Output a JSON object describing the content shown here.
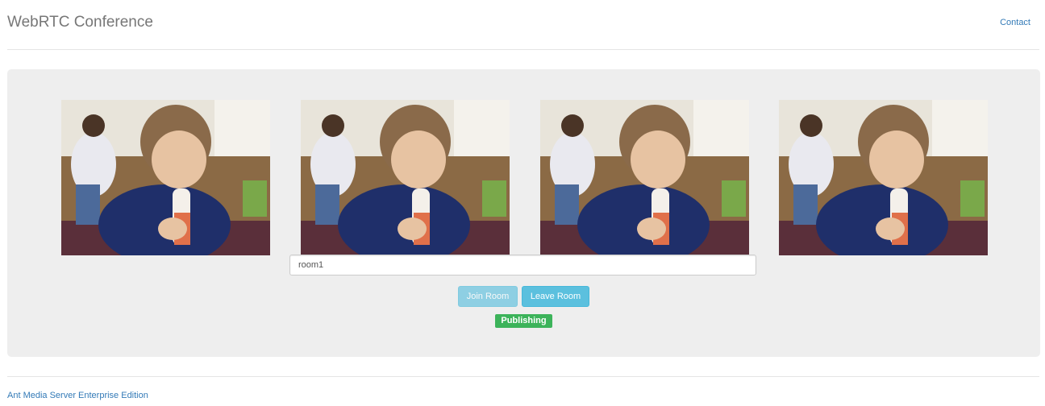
{
  "header": {
    "title": "WebRTC Conference",
    "contact_label": "Contact"
  },
  "videos": [
    {
      "label": "local-video"
    },
    {
      "label": "remote-video-1"
    },
    {
      "label": "remote-video-2"
    },
    {
      "label": "remote-video-3"
    }
  ],
  "room": {
    "value": "room1"
  },
  "buttons": {
    "join_label": "Join Room",
    "leave_label": "Leave Room"
  },
  "status": {
    "label": "Publishing"
  },
  "footer": {
    "link_label": "Ant Media Server Enterprise Edition"
  },
  "colors": {
    "info_button": "#5bc0de",
    "publishing_badge": "#3cb35a",
    "link": "#337ab7",
    "jumbotron_bg": "#eeeeee"
  }
}
